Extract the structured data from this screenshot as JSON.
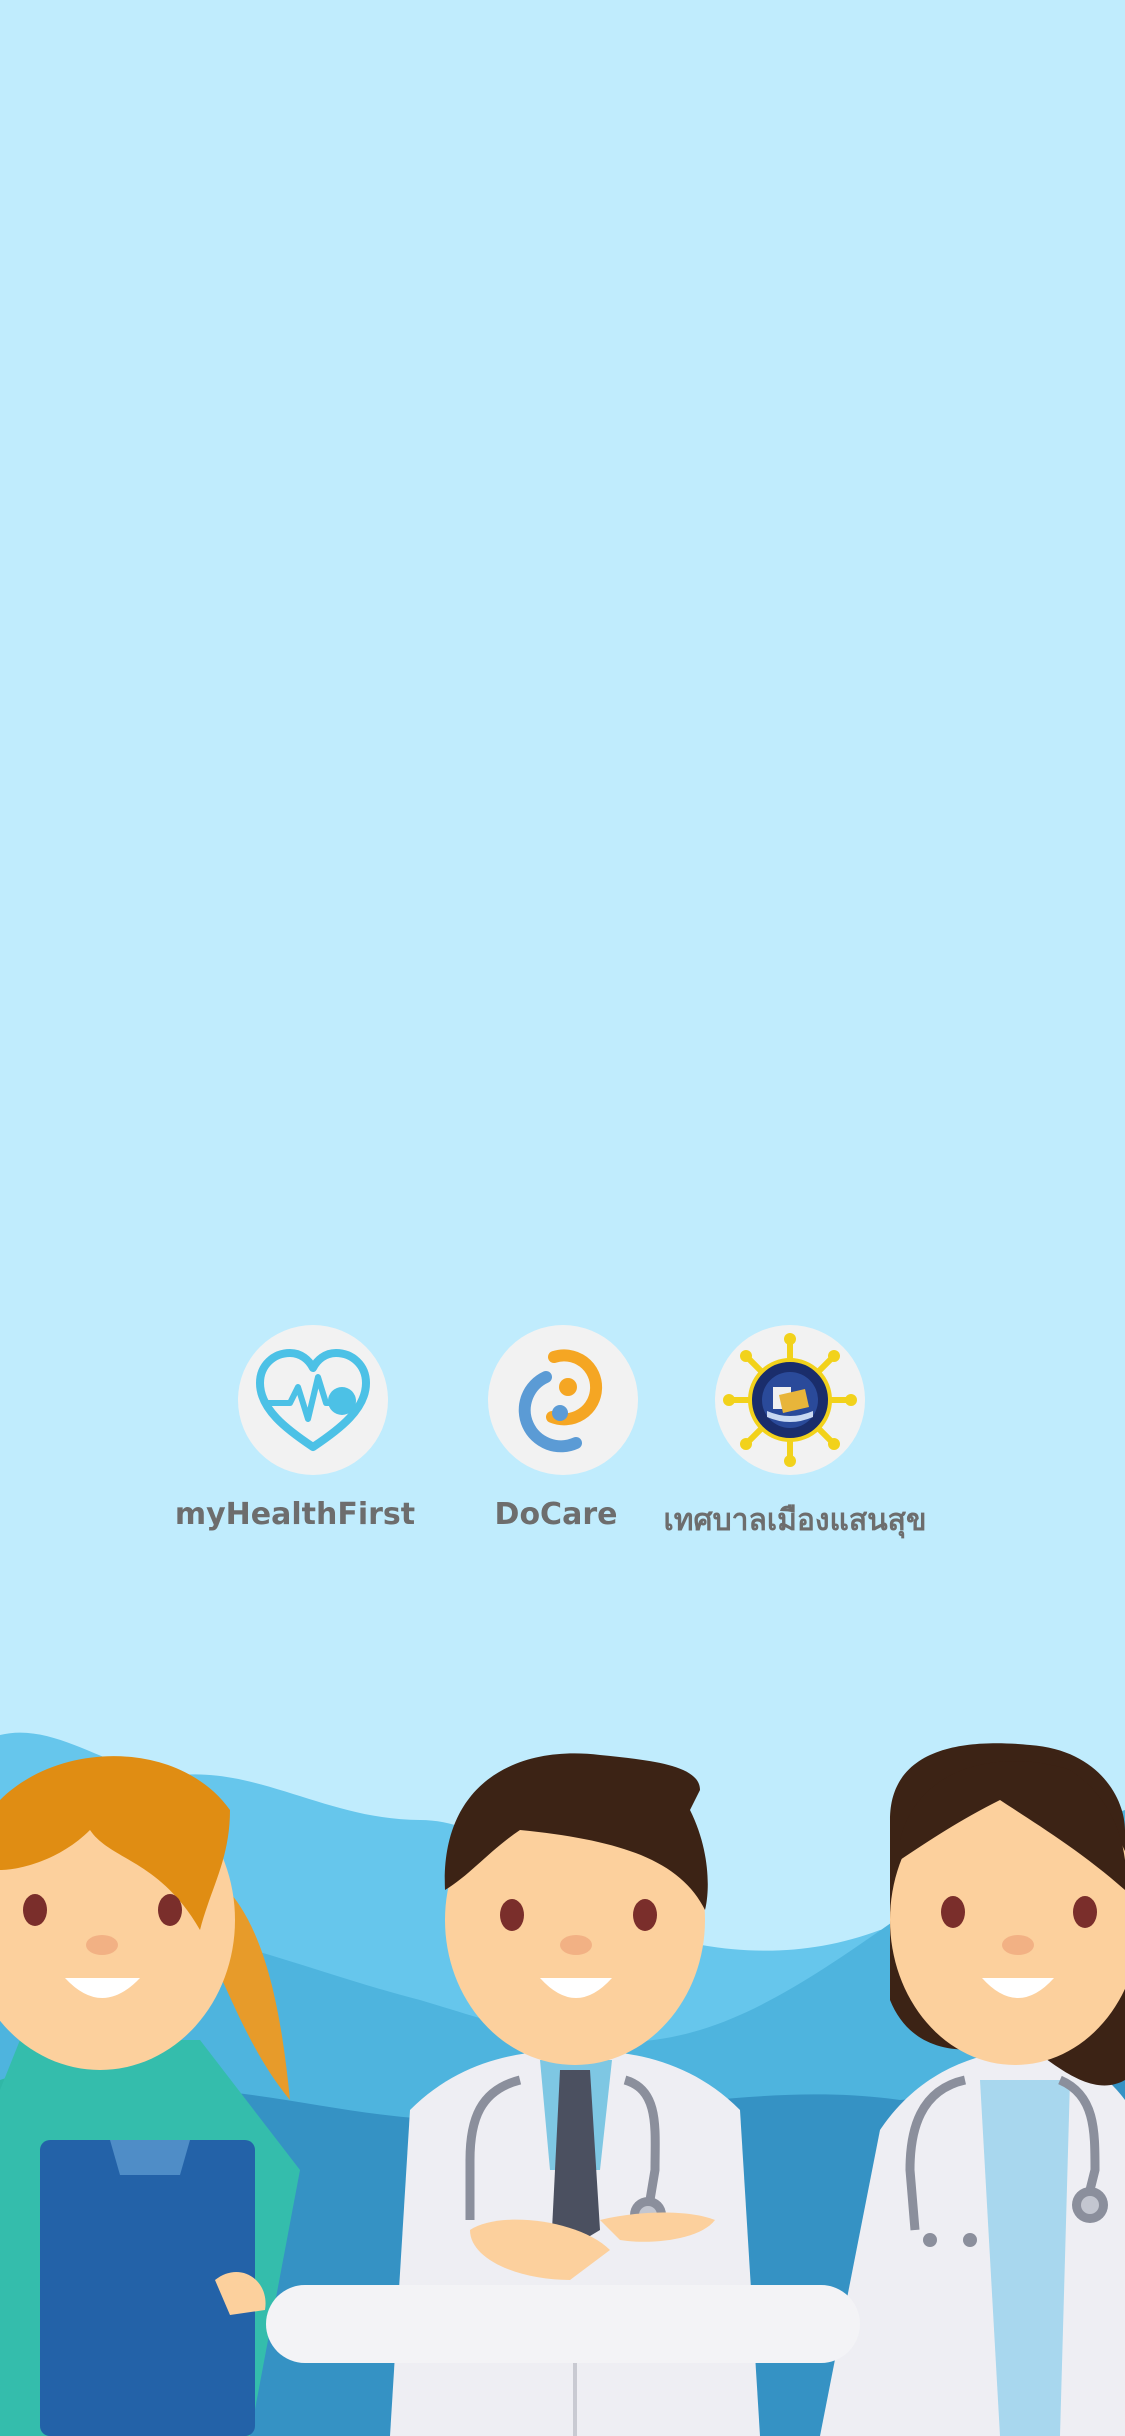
{
  "partners": [
    {
      "name": "myHealthFirst",
      "icon": "heart-pulse-icon",
      "colors": {
        "primary": "#4cc1e6"
      }
    },
    {
      "name": "DoCare",
      "icon": "docare-logo",
      "colors": {
        "primary": "#f5a623",
        "secondary": "#5b9bd5"
      }
    },
    {
      "name": "เทศบาลเมืองแสนสุข",
      "icon": "municipality-seal",
      "colors": {
        "primary": "#f2d21b",
        "secondary": "#1a2d6b"
      }
    }
  ],
  "theme": {
    "background": "#c0ecfd",
    "label_color": "#6d6d6d",
    "bottom_bar": "#f3f3f6"
  }
}
